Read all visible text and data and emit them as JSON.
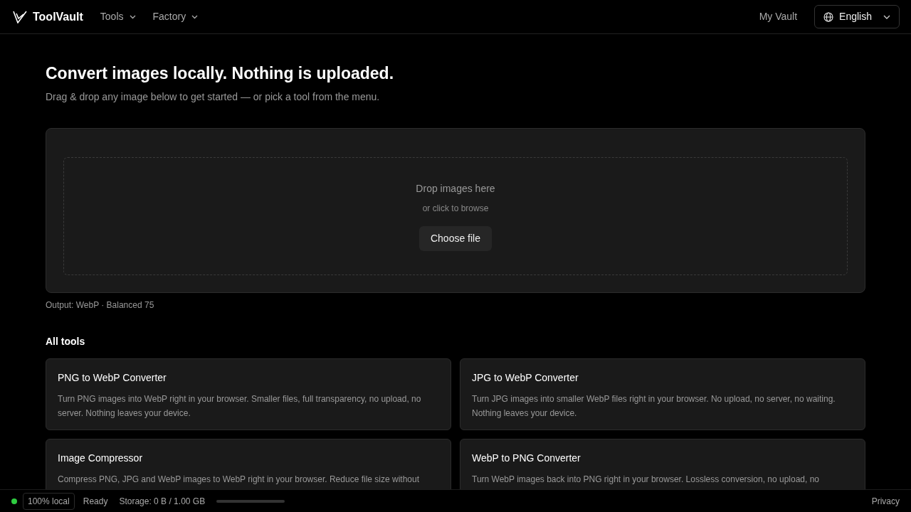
{
  "navbar": {
    "brand": "ToolVault",
    "menus": [
      {
        "label": "Tools"
      },
      {
        "label": "Factory"
      }
    ],
    "vault_link": "My Vault",
    "language": "English"
  },
  "hero": {
    "title": "Convert images locally. Nothing is uploaded.",
    "subtitle": "Drag & drop any image below to get started — or pick a tool from the menu."
  },
  "dropzone": {
    "title": "Drop images here",
    "hint": "or click to browse",
    "button": "Choose file"
  },
  "output_note": "Output: WebP · Balanced 75",
  "tools_heading": "All tools",
  "tools": [
    {
      "title": "PNG to WebP Converter",
      "description": "Turn PNG images into WebP right in your browser. Smaller files, full transparency, no upload, no server. Nothing leaves your device."
    },
    {
      "title": "JPG to WebP Converter",
      "description": "Turn JPG images into smaller WebP files right in your browser. No upload, no server, no waiting. Nothing leaves your device."
    },
    {
      "title": "Image Compressor",
      "description": "Compress PNG, JPG and WebP images to WebP right in your browser. Reduce file size without"
    },
    {
      "title": "WebP to PNG Converter",
      "description": "Turn WebP images back into PNG right in your browser. Lossless conversion, no upload, no"
    }
  ],
  "status_bar": {
    "online": true,
    "badge": "100% local",
    "status": "Ready",
    "storage": "Storage: 0 B / 1.00 GB",
    "level": 0,
    "privacy": "Privacy"
  }
}
